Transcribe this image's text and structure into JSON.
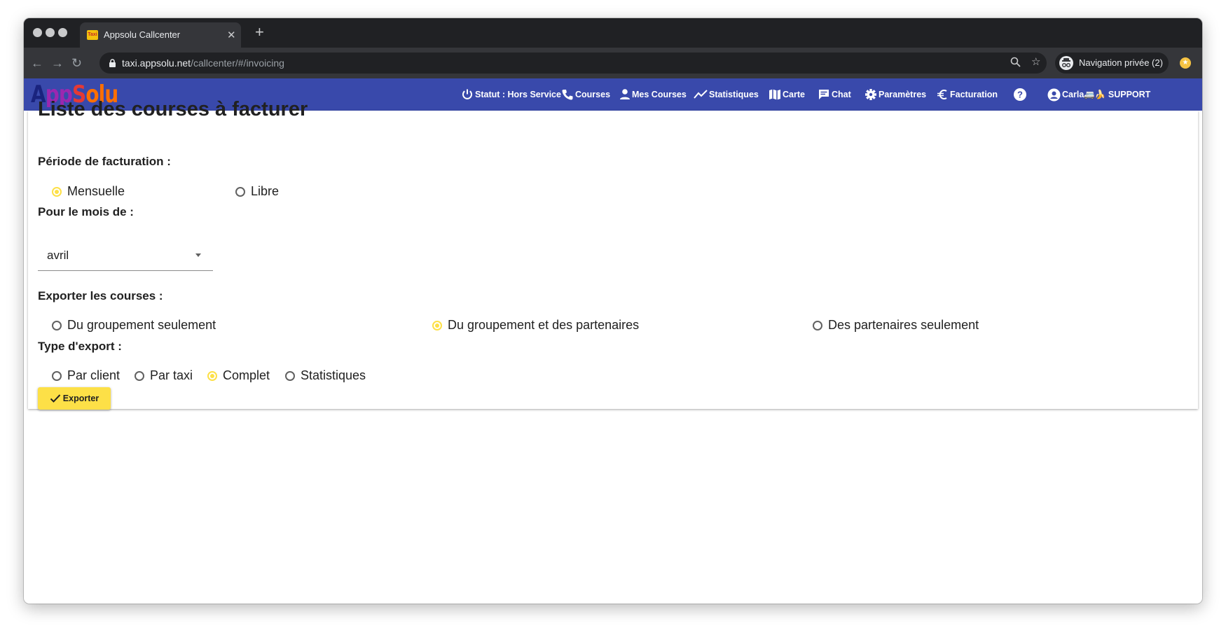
{
  "browser": {
    "tab_title": "Appsolu Callcenter",
    "tab_favicon": "Taxi",
    "url_host": "taxi.appsolu.net",
    "url_path": "/callcenter/#/invoicing",
    "incognito_label": "Navigation privée (2)"
  },
  "app": {
    "logo": {
      "part1": "A",
      "part2": "pp",
      "part3": "S",
      "part4": "olu"
    },
    "nav": {
      "statut": "Statut : Hors Service",
      "courses": "Courses",
      "mes_courses": "Mes Courses",
      "statistiques": "Statistiques",
      "carte": "Carte",
      "chat": "Chat",
      "parametres": "Paramètres",
      "facturation": "Facturation",
      "user": "Carla🚐🍌 SUPPORT"
    },
    "colors": {
      "header": "#3949ab",
      "accent": "#fde047"
    }
  },
  "page": {
    "title": "Liste des courses à facturer",
    "periode_label": "Période de facturation :",
    "periode_options": {
      "mensuelle": "Mensuelle",
      "libre": "Libre"
    },
    "periode_selected": "Mensuelle",
    "mois_label": "Pour le mois de :",
    "mois_value": "avril",
    "exporter_label": "Exporter les courses :",
    "exporter_options": {
      "groupement": "Du groupement seulement",
      "groupement_partenaires": "Du groupement et des partenaires",
      "partenaires": "Des partenaires seulement"
    },
    "exporter_selected": "Du groupement et des partenaires",
    "type_label": "Type d'export :",
    "type_options": {
      "client": "Par client",
      "taxi": "Par taxi",
      "complet": "Complet",
      "statistiques": "Statistiques"
    },
    "type_selected": "Complet",
    "export_button": "Exporter"
  }
}
